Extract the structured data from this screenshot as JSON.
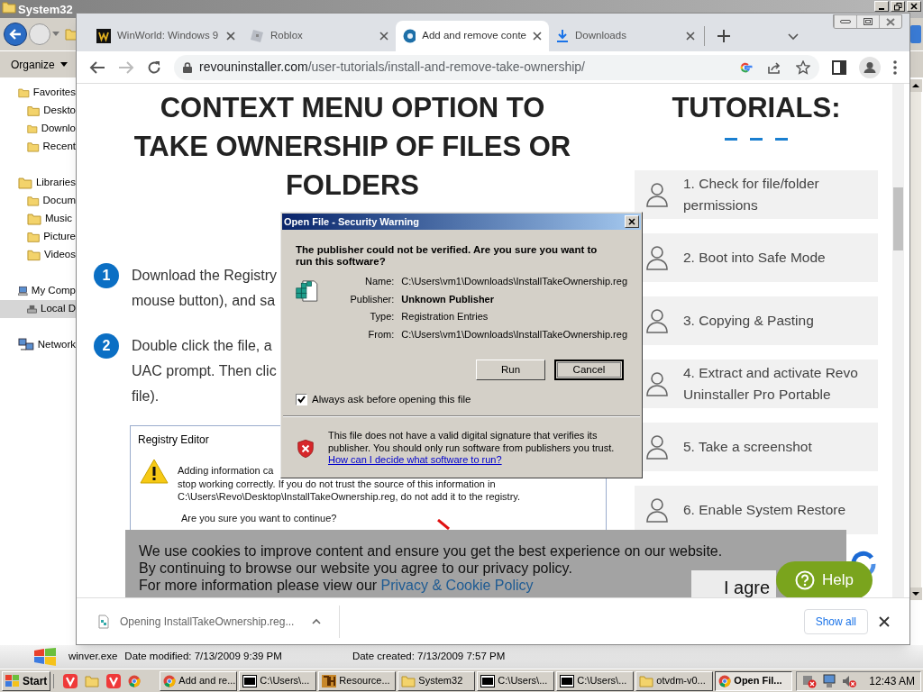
{
  "explorer": {
    "title": "System32",
    "organize": "Organize",
    "nav": [
      {
        "label": "Favorites",
        "kind": "folder",
        "selected": false,
        "children": [
          {
            "label": "Deskto",
            "kind": "folder",
            "selected": false
          },
          {
            "label": "Downlo",
            "kind": "folder",
            "selected": false
          },
          {
            "label": "Recent",
            "kind": "folder",
            "selected": false
          }
        ]
      },
      {
        "label": "Libraries",
        "kind": "folder",
        "selected": false,
        "children": [
          {
            "label": "Docum",
            "kind": "folder",
            "selected": false
          },
          {
            "label": "Music",
            "kind": "folder",
            "selected": false
          },
          {
            "label": "Picture",
            "kind": "folder",
            "selected": false
          },
          {
            "label": "Videos",
            "kind": "folder",
            "selected": false
          }
        ]
      },
      {
        "label": "My Comp",
        "kind": "computer",
        "selected": false,
        "children": [
          {
            "label": "Local D",
            "kind": "drive",
            "selected": true
          }
        ]
      },
      {
        "label": "Network",
        "kind": "network",
        "selected": false
      }
    ],
    "details": {
      "file_name": "winver.exe",
      "fields": [
        "Date modified: 7/13/2009 9:39 PM",
        "Date created: 7/13/2009 7:57 PM"
      ]
    }
  },
  "browser": {
    "tabs": [
      {
        "label": "WinWorld: Windows 9",
        "kind": "winworld",
        "selected": false
      },
      {
        "label": "Roblox",
        "kind": "roblox",
        "selected": false
      },
      {
        "label": "Add and remove conte",
        "kind": "revo",
        "selected": true
      },
      {
        "label": "Downloads",
        "kind": "download",
        "selected": false
      }
    ],
    "address": {
      "domain": "revouninstaller.com",
      "path": "/user-tutorials/install-and-remove-take-ownership/"
    },
    "article": {
      "title": [
        "CONTEXT MENU OPTION TO",
        "TAKE OWNERSHIP OF FILES OR",
        "FOLDERS"
      ],
      "steps": [
        {
          "number": "1",
          "lines": [
            "Download the Registry",
            "mouse button), and sa"
          ]
        },
        {
          "number": "2",
          "lines": [
            "Double click the file, a",
            "UAC prompt. Then clic",
            "file)."
          ]
        }
      ],
      "registry_screenshot": {
        "title": "Registry Editor",
        "lines": [
          "Adding information ca",
          "stop working correctly. If you do not trust the source of this information in",
          "C:\\Users\\Revo\\Desktop\\InstallTakeOwnership.reg, do not add it to the registry."
        ],
        "question": "Are you sure you want to continue?"
      }
    },
    "sidebar": {
      "heading": "TUTORIALS:",
      "items": [
        "1. Check for file/folder permissions",
        "2. Boot into Safe Mode",
        "3. Copying & Pasting",
        "4. Extract and activate Revo Uninstaller Pro Portable",
        "5. Take a screenshot",
        "6. Enable System Restore"
      ]
    },
    "cookie_banner": {
      "lines": [
        "We use cookies to improve content and ensure you get the best experience on our website.",
        "By continuing to browse our website you agree to our privacy policy.",
        "For more information please view our"
      ],
      "link": "Privacy & Cookie Policy",
      "agree_button": "I agre"
    },
    "help_button": "Help",
    "download_bar": {
      "file": "Opening InstallTakeOwnership.reg...",
      "show_all": "Show all"
    }
  },
  "dialog": {
    "title": "Open File - Security Warning",
    "question": "The publisher could not be verified.  Are you sure you want to run this software?",
    "fields": [
      {
        "label": "Name:",
        "value": "C:\\Users\\vm1\\Downloads\\InstallTakeOwnership.reg",
        "bold": false
      },
      {
        "label": "Publisher:",
        "value": "Unknown Publisher",
        "bold": true
      },
      {
        "label": "Type:",
        "value": "Registration Entries",
        "bold": false
      },
      {
        "label": "From:",
        "value": "C:\\Users\\vm1\\Downloads\\InstallTakeOwnership.reg",
        "bold": false
      }
    ],
    "buttons": [
      {
        "label": "Run",
        "focused": false
      },
      {
        "label": "Cancel",
        "focused": true
      }
    ],
    "always_ask": {
      "label": "Always ask before opening this file",
      "checked": true
    },
    "warning": "This file does not have a valid digital signature that verifies its publisher.  You should only run software from publishers you trust.",
    "help_link": "How can I decide what software to run?"
  },
  "taskbar": {
    "start": "Start",
    "tasks": [
      {
        "label": "Add and re...",
        "kind": "chrome",
        "selected": false
      },
      {
        "label": "C:\\Users\\...",
        "kind": "sevenzip",
        "selected": false
      },
      {
        "label": "Resource...",
        "kind": "reshacker",
        "selected": false
      },
      {
        "label": "System32",
        "kind": "folder",
        "selected": false
      },
      {
        "label": "C:\\Users\\...",
        "kind": "sevenzip",
        "selected": false
      },
      {
        "label": "C:\\Users\\...",
        "kind": "sevenzip",
        "selected": false
      },
      {
        "label": "otvdm-v0...",
        "kind": "folder",
        "selected": false
      },
      {
        "label": "Open Fil...",
        "kind": "chrome",
        "selected": true
      }
    ],
    "clock": "12:43 AM"
  }
}
